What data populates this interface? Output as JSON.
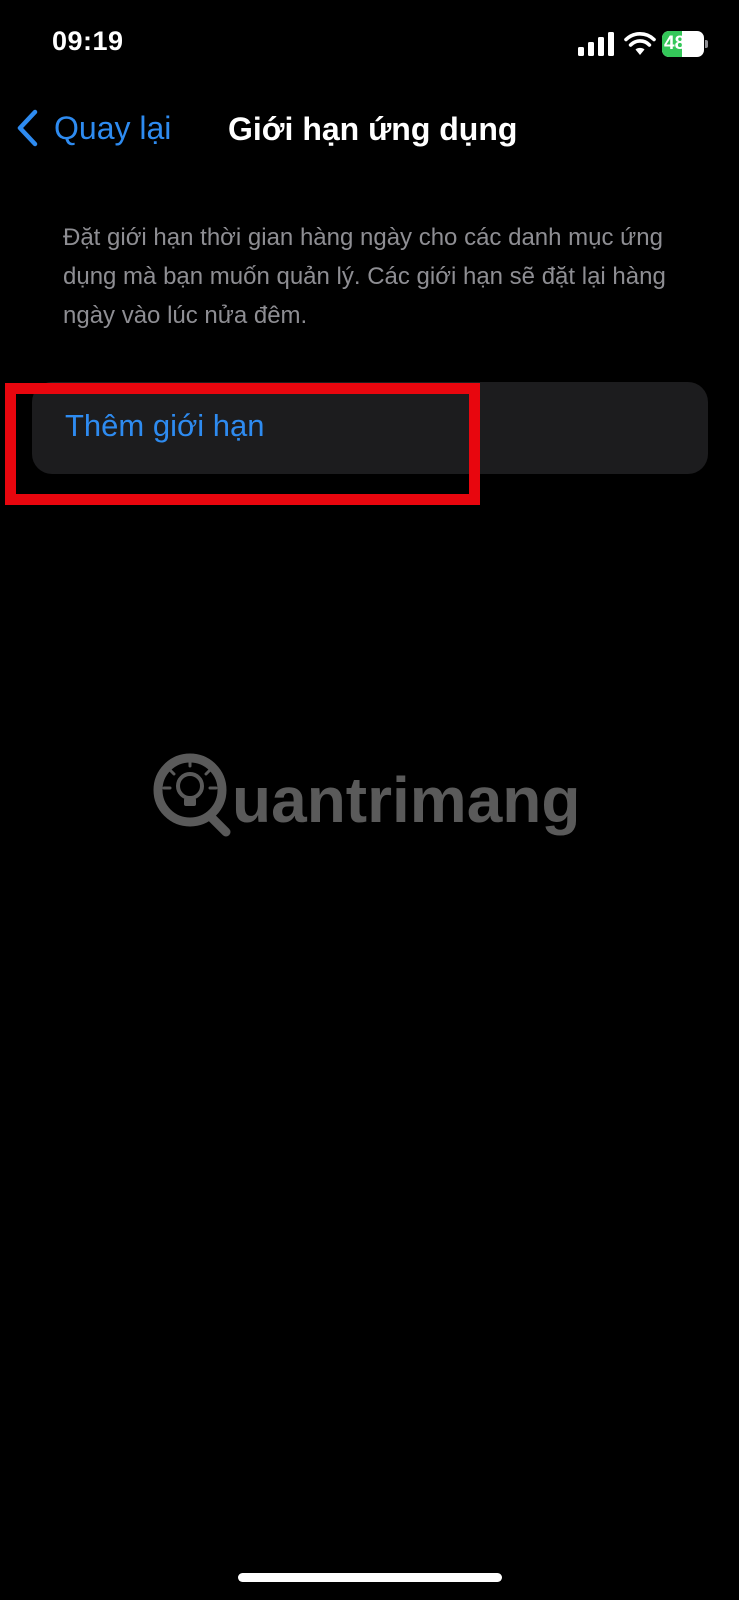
{
  "status_bar": {
    "time": "09:19",
    "battery_level": "48",
    "battery_percent": 48,
    "battery_color": "#34c759",
    "charging": true,
    "signal_icon": "cellular-signal-icon",
    "wifi_icon": "wifi-icon"
  },
  "nav": {
    "back_label": "Quay lại",
    "back_icon": "chevron-left-icon",
    "title": "Giới hạn ứng dụng"
  },
  "description": "Đặt giới hạn thời gian hàng ngày cho các danh mục ứng dụng mà bạn muốn quản lý. Các giới hạn sẽ đặt lại hàng ngày vào lúc nửa đêm.",
  "actions": {
    "add_limit_label": "Thêm giới hạn"
  },
  "annotation": {
    "highlight_color": "#e8060e"
  },
  "watermark": {
    "text": "uantrimang"
  },
  "colors": {
    "background": "#000000",
    "accent": "#2e8bf0",
    "cell_background": "#1c1c1e",
    "secondary_text": "#8e8e93"
  }
}
